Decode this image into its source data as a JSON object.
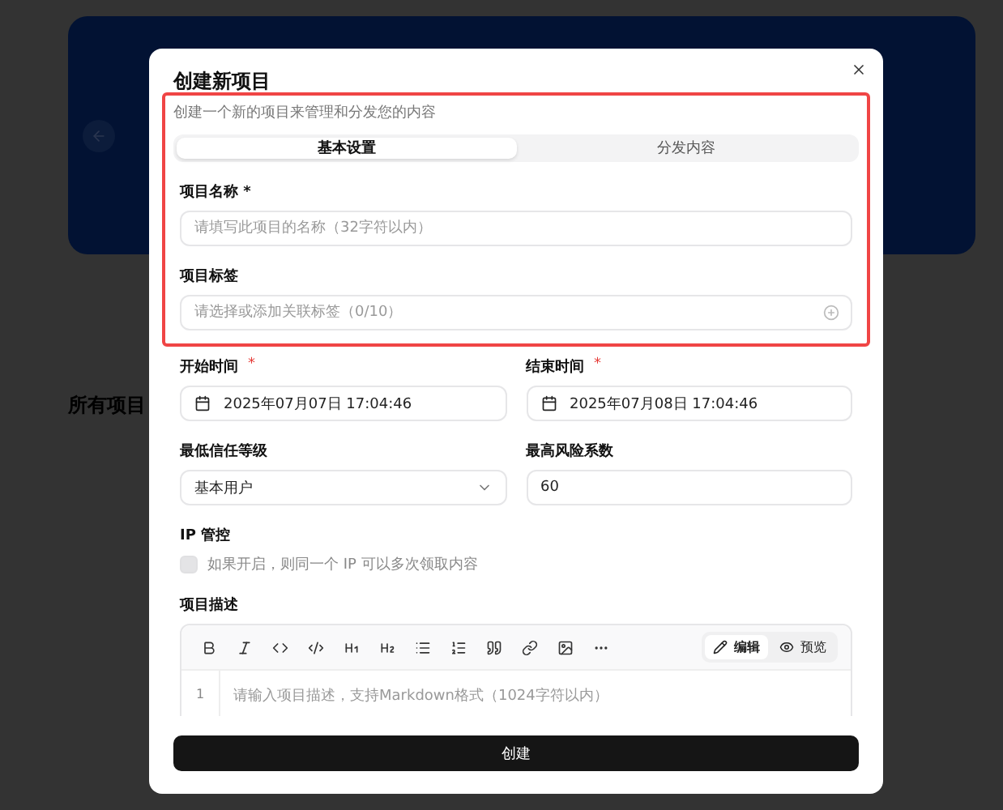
{
  "background": {
    "page_heading": "所有项目"
  },
  "dialog": {
    "title": "创建新项目",
    "subtitle": "创建一个新的项目来管理和分发您的内容",
    "tabs": [
      {
        "label": "基本设置",
        "selected": true
      },
      {
        "label": "分发内容",
        "selected": false
      }
    ],
    "name_field": {
      "label": "项目名称 *",
      "placeholder": "请填写此项目的名称（32字符以内）"
    },
    "tags_field": {
      "label": "项目标签",
      "placeholder": "请选择或添加关联标签（0/10）"
    },
    "start_time": {
      "label": "开始时间",
      "required_mark": "*",
      "value": "2025年07月07日 17:04:46"
    },
    "end_time": {
      "label": "结束时间",
      "required_mark": "*",
      "value": "2025年07月08日 17:04:46"
    },
    "trust_level": {
      "label": "最低信任等级",
      "value": "基本用户"
    },
    "max_risk": {
      "label": "最高风险系数",
      "value": "60"
    },
    "ip_control": {
      "label": "IP 管控",
      "checked": false,
      "disabled": true,
      "hint": "如果开启，则同一个 IP 可以多次领取内容"
    },
    "description": {
      "label": "项目描述",
      "modes": [
        {
          "label": "编辑",
          "selected": true
        },
        {
          "label": "预览",
          "selected": false
        }
      ],
      "line_number": "1",
      "placeholder": "请输入项目描述，支持Markdown格式（1024字符以内）"
    },
    "submit": "创建"
  }
}
